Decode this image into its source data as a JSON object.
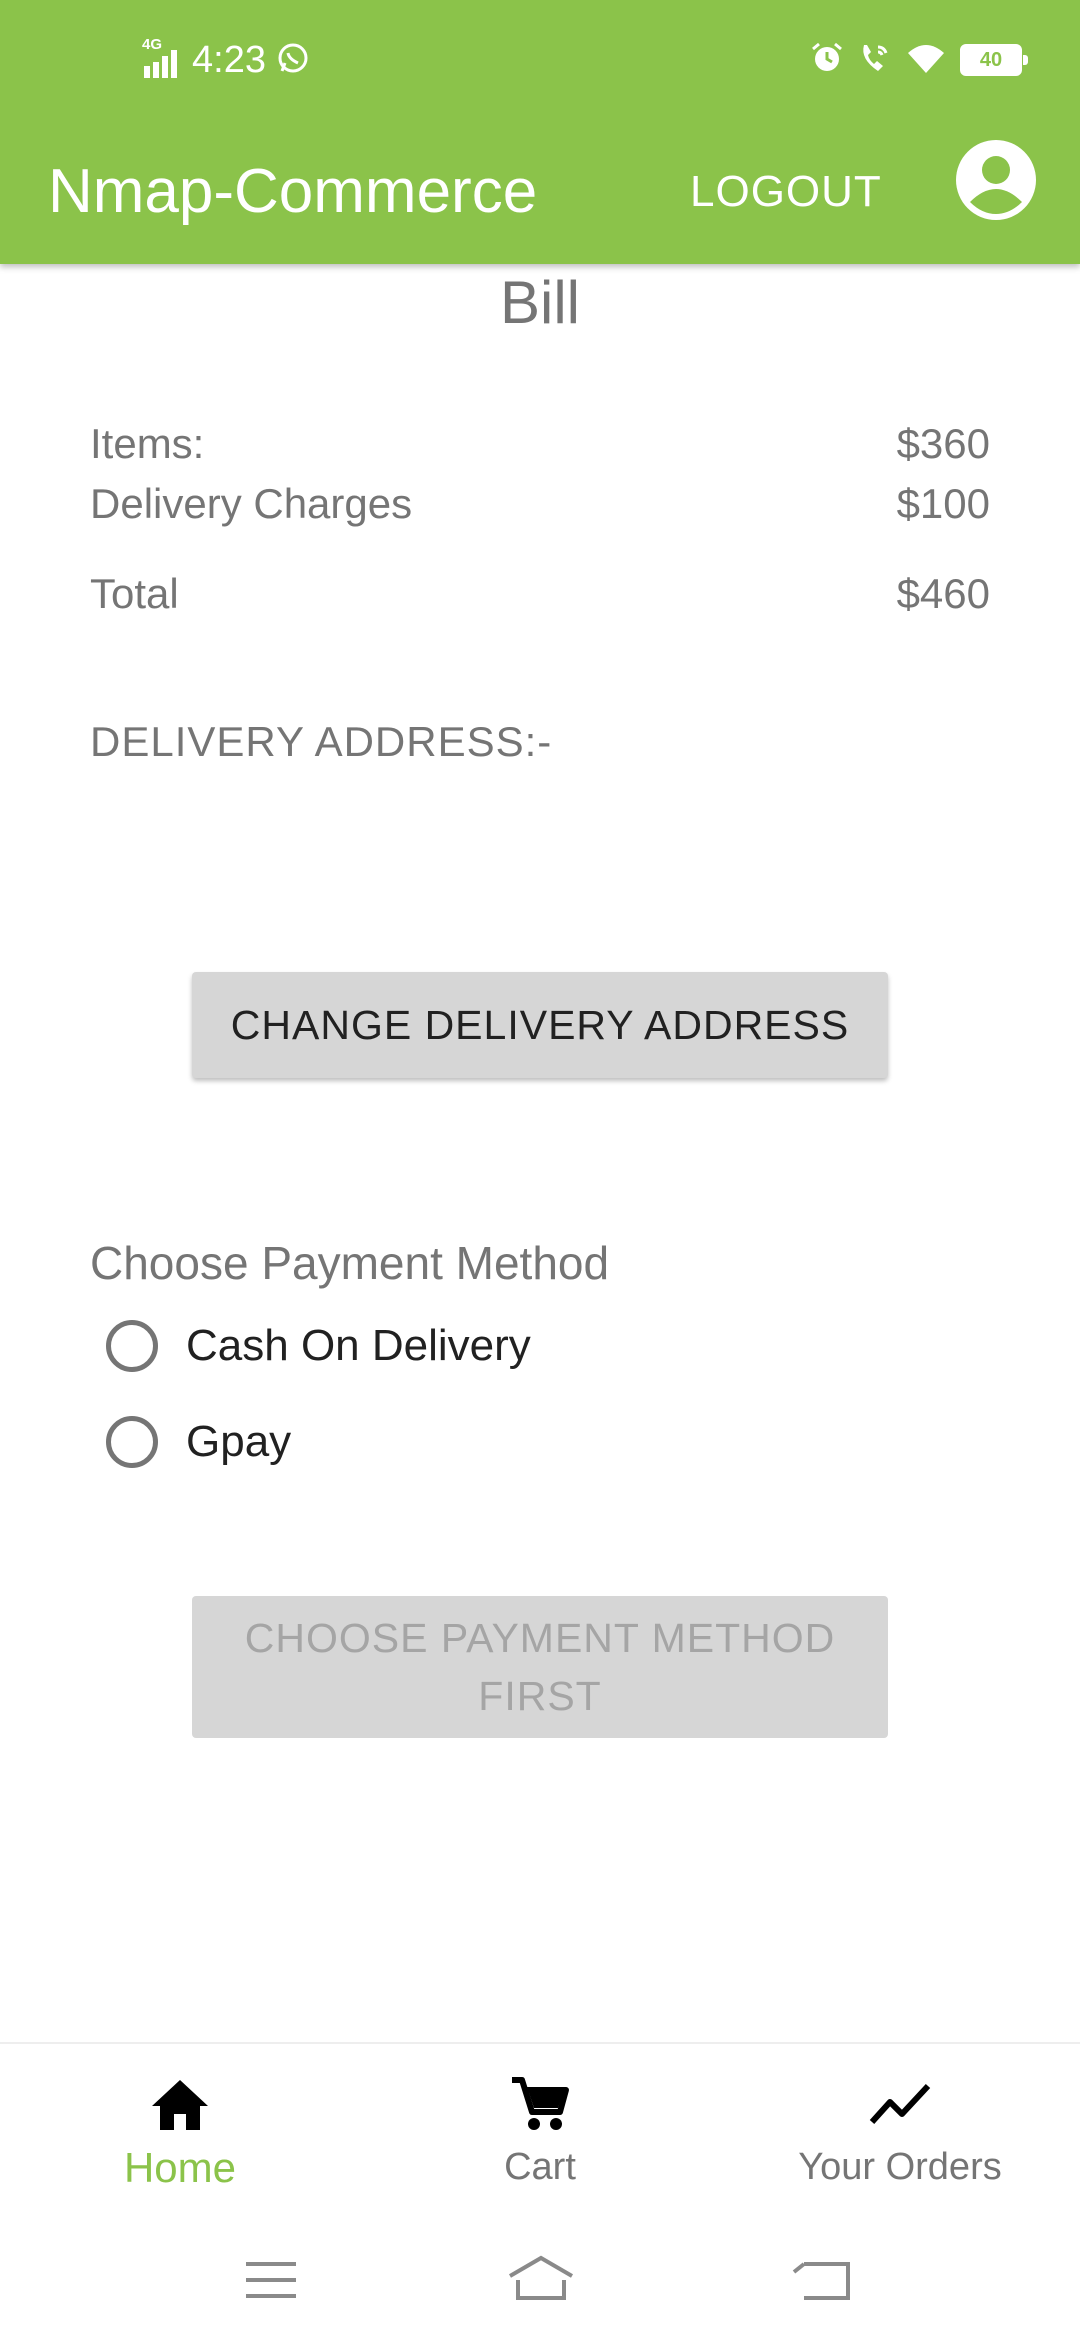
{
  "status_bar": {
    "network": "4G",
    "time": "4:23",
    "battery": "40"
  },
  "toolbar": {
    "title": "Nmap-Commerce",
    "logout_label": "LOGOUT"
  },
  "bill": {
    "title": "Bill",
    "rows": [
      {
        "label": "Items:",
        "value": "$360"
      },
      {
        "label": "Delivery Charges",
        "value": "$100"
      },
      {
        "label": "Total",
        "value": "$460"
      }
    ],
    "delivery_address_label": "DELIVERY ADDRESS:-",
    "change_address_label": "CHANGE DELIVERY ADDRESS"
  },
  "payment": {
    "title": "Choose Payment Method",
    "options": [
      {
        "label": "Cash On Delivery",
        "selected": false
      },
      {
        "label": "Gpay",
        "selected": false
      }
    ],
    "submit_label": "CHOOSE PAYMENT METHOD FIRST"
  },
  "bottom_nav": {
    "items": [
      {
        "label": "Home",
        "icon": "home-icon",
        "active": true
      },
      {
        "label": "Cart",
        "icon": "cart-icon",
        "active": false
      },
      {
        "label": "Your Orders",
        "icon": "trending-up-icon",
        "active": false
      }
    ]
  },
  "colors": {
    "primary": "#8bc34a",
    "text_secondary": "#757575",
    "button_bg": "#d6d6d6"
  }
}
